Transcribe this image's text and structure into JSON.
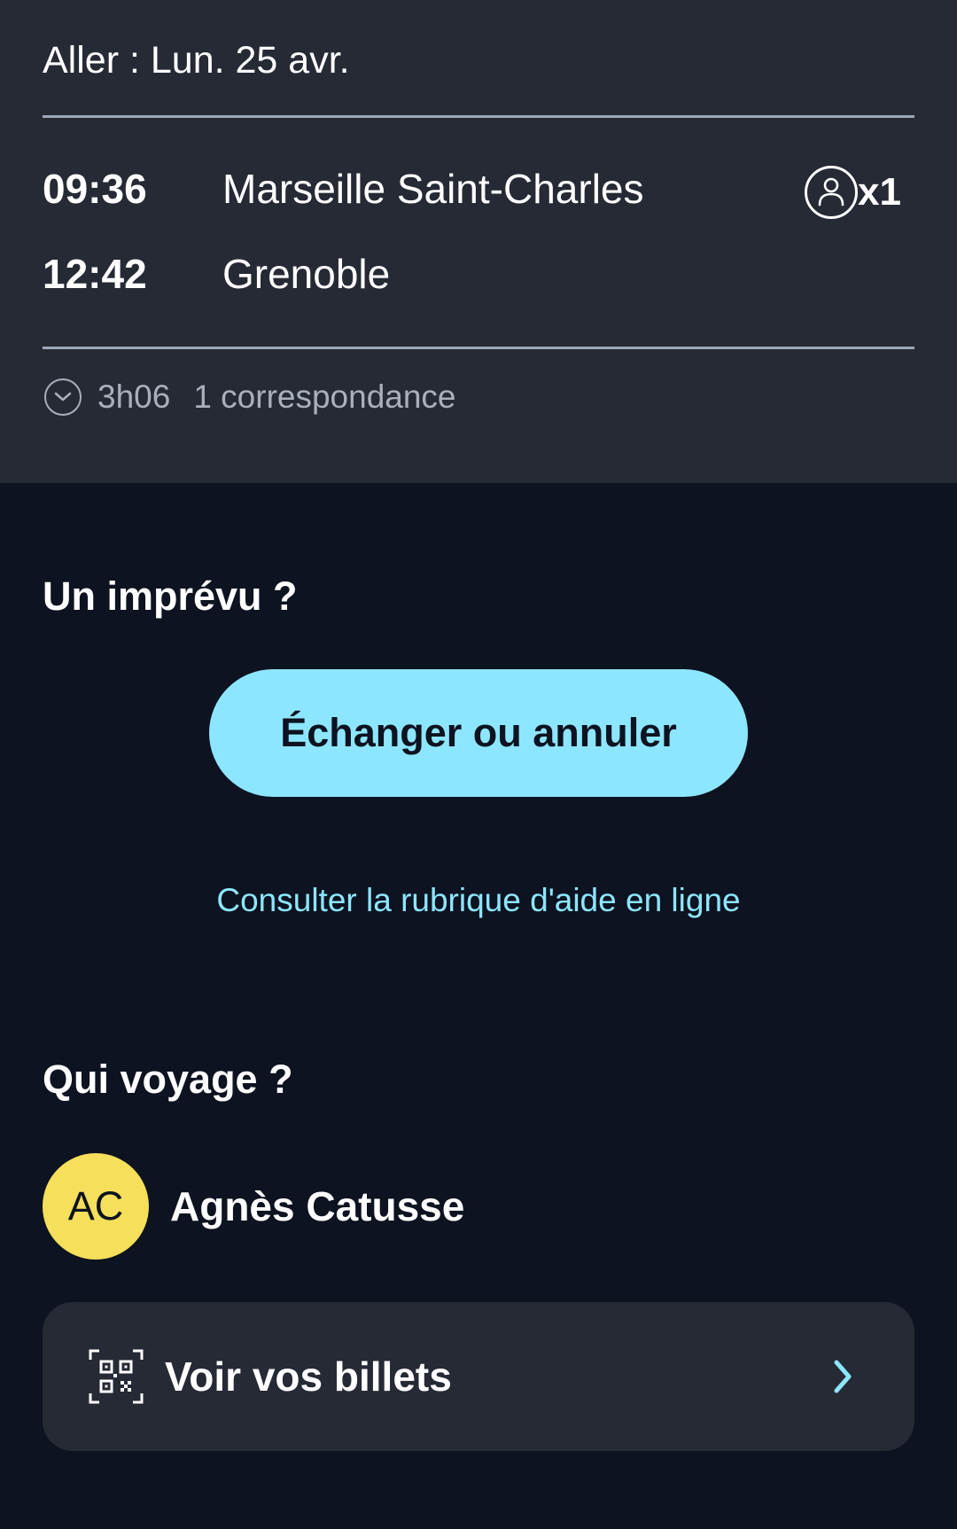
{
  "trip": {
    "title": "Aller : Lun. 25 avr.",
    "departure_time": "09:36",
    "departure_station": "Marseille Saint-Charles",
    "arrival_time": "12:42",
    "arrival_station": "Grenoble",
    "passenger_count": "x1",
    "duration": "3h06",
    "connections": "1 correspondance"
  },
  "unexpected": {
    "title": "Un imprévu ?",
    "exchange_button": "Échanger ou annuler",
    "help_link": "Consulter la rubrique d'aide en ligne"
  },
  "travellers": {
    "title": "Qui voyage ?",
    "list": [
      {
        "initials": "AC",
        "name": "Agnès Catusse"
      }
    ]
  },
  "tickets": {
    "label": "Voir vos billets"
  },
  "colors": {
    "background": "#0d1320",
    "card": "#252a35",
    "accent": "#8de6ff",
    "avatar": "#f6df5b",
    "muted": "#a9afbb"
  },
  "icons": {
    "passenger": "user-icon",
    "duration": "clock-icon",
    "tickets": "qr-code-icon",
    "chevron": "chevron-right-icon"
  }
}
